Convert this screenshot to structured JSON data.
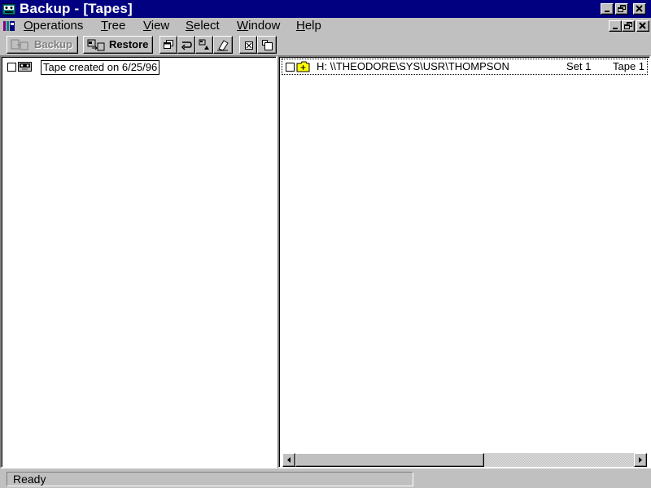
{
  "window": {
    "title": "Backup - [Tapes]",
    "colors": {
      "titlebar": "#000080",
      "face": "#c0c0c0",
      "window": "#ffffff"
    }
  },
  "menubar": {
    "items": [
      "Operations",
      "Tree",
      "View",
      "Select",
      "Window",
      "Help"
    ]
  },
  "toolbar": {
    "backup_label": "Backup",
    "restore_label": "Restore",
    "backup_state": "disabled"
  },
  "tree_pane": {
    "items": [
      {
        "label": "Tape created on 6/25/96",
        "icon": "tape-icon",
        "checked": false
      }
    ]
  },
  "detail_pane": {
    "items": [
      {
        "path": "H: \\\\THEODORE\\SYS\\USR\\THOMPSON",
        "set": "Set 1",
        "tape": "Tape 1",
        "icon": "folder-icon",
        "checked": false
      }
    ]
  },
  "statusbar": {
    "text": "Ready"
  }
}
